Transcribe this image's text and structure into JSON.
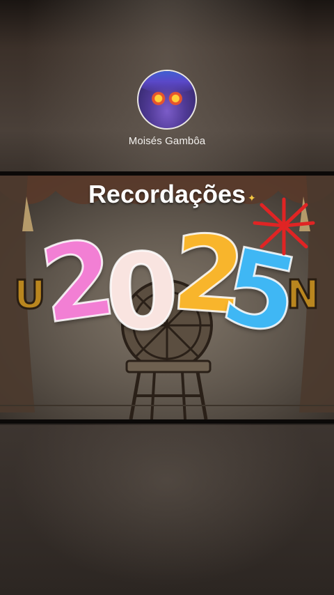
{
  "profile": {
    "username": "Moisés Gambôa"
  },
  "video": {
    "title": "Recordações",
    "year_digits": [
      "2",
      "0",
      "2",
      "5"
    ],
    "background_sign_left": "U",
    "background_sign_right": "N"
  },
  "colors": {
    "digit_1": "#f27fd4",
    "digit_2": "#f9e4e0",
    "digit_3": "#f8b52c",
    "digit_4": "#3fb7f4"
  }
}
